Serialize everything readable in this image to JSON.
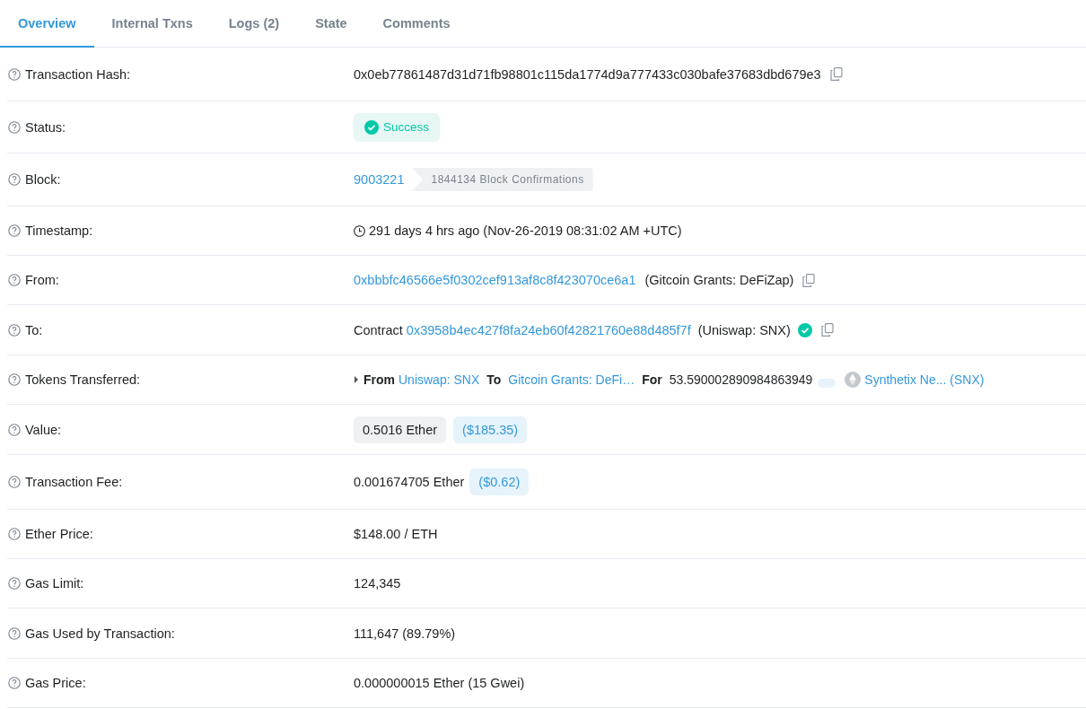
{
  "tabs": [
    {
      "label": "Overview",
      "selected": true
    },
    {
      "label": "Internal Txns",
      "selected": false
    },
    {
      "label": "Logs (2)",
      "selected": false
    },
    {
      "label": "State",
      "selected": false
    },
    {
      "label": "Comments",
      "selected": false
    }
  ],
  "rows": [
    {
      "label": "Transaction Hash:",
      "kind": "hash",
      "text": "0x0eb77861487d31d71fb98801c115da1774d9a777433c030bafe37683dbd679e3"
    },
    {
      "label": "Status:",
      "kind": "status",
      "text": "Success"
    },
    {
      "label": "Block:",
      "kind": "block",
      "link": "9003221",
      "confirmations": "1844134 Block Confirmations"
    },
    {
      "label": "Timestamp:",
      "kind": "timestamp",
      "text": "291 days 4 hrs ago (Nov-26-2019 08:31:02 AM +UTC)"
    },
    {
      "label": "From:",
      "kind": "address",
      "link": "0xbbbfc46566e5f0302cef913af8c8f423070ce6a1",
      "note": "(Gitcoin Grants: DeFiZap)"
    },
    {
      "label": "To:",
      "kind": "contract",
      "prefix": "Contract",
      "link": "0x3958b4ec427f8fa24eb60f42821760e88d485f7f",
      "note": "(Uniswap: SNX)",
      "verified": true
    },
    {
      "label": "Tokens Transferred:",
      "kind": "tokens",
      "from_word": "From",
      "from": "Uniswap: SNX",
      "to_word": "To",
      "to": "Gitcoin Grants: DeFi…",
      "for_word": "For",
      "amount": "53.590002890984863949",
      "token": "Synthetix Ne... (SNX)"
    },
    {
      "label": "Value:",
      "kind": "value",
      "amount": "0.5016 Ether",
      "usd": "($185.35)"
    },
    {
      "label": "Transaction Fee:",
      "kind": "fee",
      "amount": "0.001674705 Ether",
      "usd": "($0.62)"
    },
    {
      "label": "Ether Price:",
      "kind": "text",
      "text": "$148.00 / ETH"
    },
    {
      "label": "Gas Limit:",
      "kind": "text",
      "text": "124,345"
    },
    {
      "label": "Gas Used by Transaction:",
      "kind": "text",
      "text": "111,647 (89.79%)"
    },
    {
      "label": "Gas Price:",
      "kind": "text",
      "text": "0.000000015 Ether (15 Gwei)"
    }
  ]
}
